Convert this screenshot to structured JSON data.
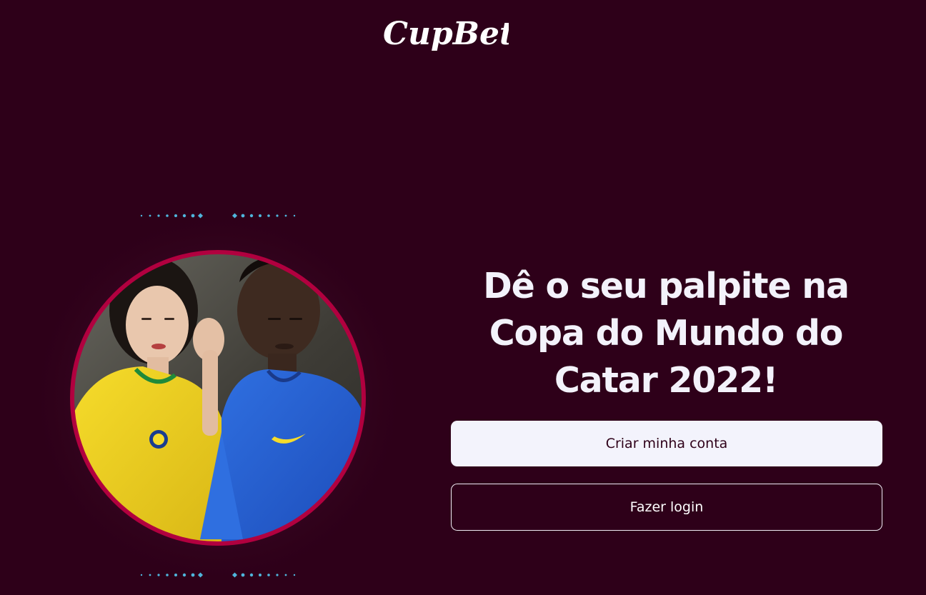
{
  "brand": {
    "logo_text": "CupBet"
  },
  "hero": {
    "headline": "Dê o seu palpite na Copa do Mundo do Catar 2022!",
    "image_alt": "Casal vestindo camisas da seleção brasileira"
  },
  "actions": {
    "create_account_label": "Criar minha conta",
    "login_label": "Fazer login"
  },
  "colors": {
    "background": "#2e0019",
    "accent_ring": "#b1003f",
    "dots": "#4fb6dd",
    "primary_button_bg": "#f3f3fc",
    "text_light": "#f3f2fb"
  }
}
